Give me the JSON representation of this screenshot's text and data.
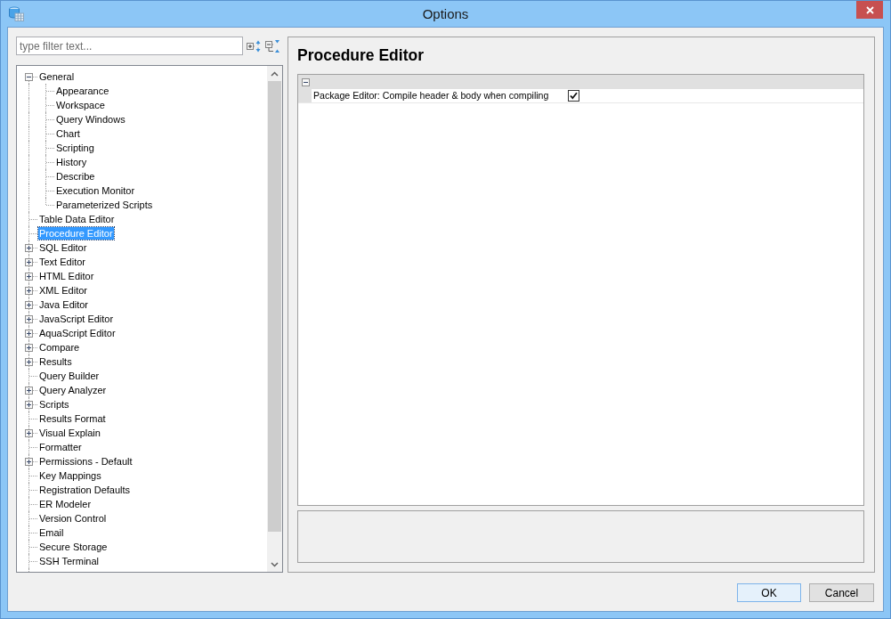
{
  "window": {
    "title": "Options"
  },
  "filter": {
    "placeholder": "type filter text..."
  },
  "tree": {
    "items": [
      {
        "label": "General",
        "expanded": true,
        "selected": false,
        "children": [
          {
            "label": "Appearance",
            "selected": false
          },
          {
            "label": "Workspace",
            "selected": false
          },
          {
            "label": "Query Windows",
            "selected": false
          },
          {
            "label": "Chart",
            "selected": false
          },
          {
            "label": "Scripting",
            "selected": false
          },
          {
            "label": "History",
            "selected": false
          },
          {
            "label": "Describe",
            "selected": false
          },
          {
            "label": "Execution Monitor",
            "selected": false
          },
          {
            "label": "Parameterized Scripts",
            "selected": false
          }
        ]
      },
      {
        "label": "Table Data Editor",
        "selected": false
      },
      {
        "label": "Procedure Editor",
        "selected": true
      },
      {
        "label": "SQL Editor",
        "expanded": false,
        "selected": false
      },
      {
        "label": "Text Editor",
        "expanded": false,
        "selected": false
      },
      {
        "label": "HTML Editor",
        "expanded": false,
        "selected": false
      },
      {
        "label": "XML Editor",
        "expanded": false,
        "selected": false
      },
      {
        "label": "Java Editor",
        "expanded": false,
        "selected": false
      },
      {
        "label": "JavaScript Editor",
        "expanded": false,
        "selected": false
      },
      {
        "label": "AquaScript Editor",
        "expanded": false,
        "selected": false
      },
      {
        "label": "Compare",
        "expanded": false,
        "selected": false
      },
      {
        "label": "Results",
        "expanded": false,
        "selected": false
      },
      {
        "label": "Query Builder",
        "selected": false
      },
      {
        "label": "Query Analyzer",
        "expanded": false,
        "selected": false
      },
      {
        "label": "Scripts",
        "expanded": false,
        "selected": false
      },
      {
        "label": "Results Format",
        "selected": false
      },
      {
        "label": "Visual Explain",
        "expanded": false,
        "selected": false
      },
      {
        "label": "Formatter",
        "selected": false
      },
      {
        "label": "Permissions - Default",
        "expanded": false,
        "selected": false
      },
      {
        "label": "Key Mappings",
        "selected": false
      },
      {
        "label": "Registration Defaults",
        "selected": false
      },
      {
        "label": "ER Modeler",
        "selected": false
      },
      {
        "label": "Version Control",
        "selected": false
      },
      {
        "label": "Email",
        "selected": false
      },
      {
        "label": "Secure Storage",
        "selected": false
      },
      {
        "label": "SSH Terminal",
        "selected": false
      }
    ]
  },
  "panel": {
    "title": "Procedure Editor",
    "property_grid": {
      "category_expanded": true,
      "rows": [
        {
          "label": "Package Editor: Compile header & body when compiling",
          "checked": true
        }
      ]
    }
  },
  "buttons": [
    {
      "label": "OK",
      "default": true
    },
    {
      "label": "Cancel",
      "default": false
    }
  ]
}
